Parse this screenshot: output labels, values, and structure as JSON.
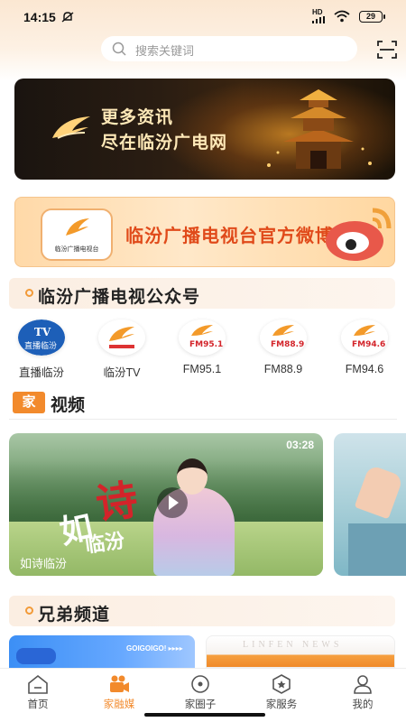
{
  "status_bar": {
    "time": "14:15",
    "network": "HD",
    "battery": "29"
  },
  "search": {
    "placeholder": "搜索关键词"
  },
  "banner_main": {
    "line1": "更多资讯",
    "line2": "尽在临汾广电网"
  },
  "banner_weibo": {
    "title": "临汾广播电视台官方微博",
    "badge_text": "临汾广播电视台"
  },
  "official_accounts": {
    "title": "临汾广播电视公众号",
    "items": [
      {
        "label": "直播临汾",
        "icon": "tv-live-icon"
      },
      {
        "label": "临汾TV",
        "icon": "linfen-tv-icon"
      },
      {
        "label": "FM95.1",
        "icon": "fm951-icon"
      },
      {
        "label": "FM88.9",
        "icon": "fm889-icon"
      },
      {
        "label": "FM94.6",
        "icon": "fm946-icon"
      }
    ]
  },
  "video_section": {
    "tag": "家",
    "title": "视频",
    "cards": [
      {
        "caption": "如诗临汾",
        "duration": "03:28",
        "overlay_ru": "如",
        "overlay_shi": "诗",
        "overlay_place": "临汾"
      }
    ]
  },
  "sibling_channels": {
    "title": "兄弟频道",
    "peek1_text": "GOIGOIGO! ▸▸▸▸",
    "peek2_text": "LINFEN NEWS"
  },
  "tabbar": {
    "tabs": [
      {
        "label": "首页",
        "active": false
      },
      {
        "label": "家融媒",
        "active": true
      },
      {
        "label": "家圈子",
        "active": false
      },
      {
        "label": "家服务",
        "active": false
      },
      {
        "label": "我的",
        "active": false
      }
    ]
  },
  "colors": {
    "accent": "#f28a2c",
    "weibo_red": "#e04a1a",
    "brand_red": "#d3242a"
  }
}
